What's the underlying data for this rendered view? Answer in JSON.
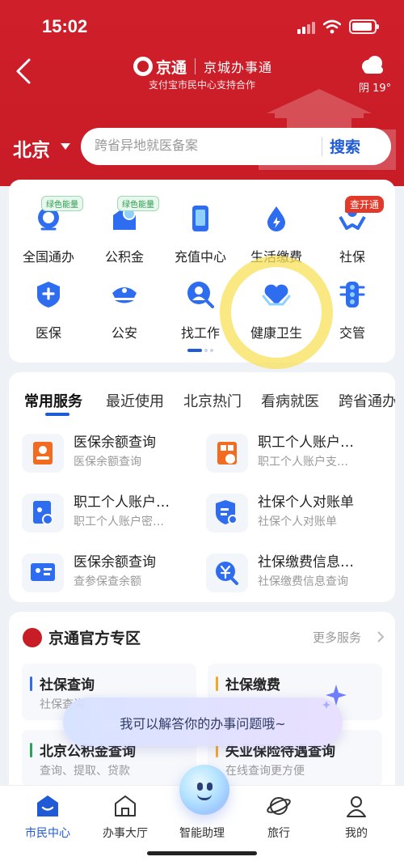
{
  "status_bar": {
    "time": "15:02"
  },
  "header": {
    "brand": "京通",
    "brand_sub": "京城办事通",
    "subtitle": "支付宝市民中心支持合作",
    "weather": "阴 19°",
    "weather_icon": "cloud-icon"
  },
  "location": {
    "city": "北京"
  },
  "search": {
    "placeholder": "跨省异地就医备案",
    "button_label": "搜索"
  },
  "grid": {
    "items": [
      {
        "label": "全国通办",
        "icon": "national-service-icon",
        "badge": "绿色能量"
      },
      {
        "label": "公积金",
        "icon": "housing-fund-icon",
        "badge": "绿色能量"
      },
      {
        "label": "充值中心",
        "icon": "phone-recharge-icon",
        "badge": ""
      },
      {
        "label": "生活缴费",
        "icon": "utility-drop-icon",
        "badge": ""
      },
      {
        "label": "社保",
        "icon": "social-security-hands-icon",
        "badge": "查开通"
      },
      {
        "label": "医保",
        "icon": "medical-insurance-icon",
        "badge": ""
      },
      {
        "label": "公安",
        "icon": "police-cap-icon",
        "badge": ""
      },
      {
        "label": "找工作",
        "icon": "job-search-icon",
        "badge": ""
      },
      {
        "label": "健康卫生",
        "icon": "health-heart-icon",
        "badge": ""
      },
      {
        "label": "交管",
        "icon": "traffic-light-icon",
        "badge": ""
      }
    ]
  },
  "services": {
    "tabs": [
      "常用服务",
      "最近使用",
      "北京热门",
      "看病就医",
      "跨省通办"
    ],
    "items": [
      {
        "title": "医保余额查询",
        "subtitle": "医保余额查询",
        "icon": "medical-balance-icon"
      },
      {
        "title": "职工个人账户…",
        "subtitle": "职工个人账户支…",
        "icon": "qr-account-icon"
      },
      {
        "title": "职工个人账户…",
        "subtitle": "职工个人账户密…",
        "icon": "account-password-icon"
      },
      {
        "title": "社保个人对账单",
        "subtitle": "社保个人对账单",
        "icon": "statement-shield-icon"
      },
      {
        "title": "医保余额查询",
        "subtitle": "查参保查余额",
        "icon": "insurance-card-icon"
      },
      {
        "title": "社保缴费信息…",
        "subtitle": "社保缴费信息查询",
        "icon": "payment-search-icon"
      }
    ]
  },
  "official": {
    "title": "京通官方专区",
    "more_label": "更多服务",
    "items": [
      {
        "title": "社保查询",
        "subtitle": "社保查询",
        "bar_color": "#2f6df0"
      },
      {
        "title": "社保缴费",
        "subtitle": "",
        "bar_color": "#f5a623"
      },
      {
        "title": "北京公积金查询",
        "subtitle": "查询、提取、贷款",
        "bar_color": "#29a35a"
      },
      {
        "title": "失业保险待遇查询",
        "subtitle": "在线查询更方便",
        "bar_color": "#f5a623"
      }
    ]
  },
  "assistant": {
    "bubble_text": "我可以解答你的办事问题哦~"
  },
  "nav": {
    "items": [
      {
        "label": "市民中心",
        "icon": "citizen-center-icon"
      },
      {
        "label": "办事大厅",
        "icon": "service-hall-icon"
      },
      {
        "label": "智能助理",
        "icon": "assistant-orb-icon"
      },
      {
        "label": "旅行",
        "icon": "travel-planet-icon"
      },
      {
        "label": "我的",
        "icon": "profile-icon"
      }
    ]
  },
  "colors": {
    "brand_red": "#c81c27",
    "accent_blue": "#1f5bd6",
    "icon_blue": "#2f6df0",
    "orange": "#f36b21"
  }
}
